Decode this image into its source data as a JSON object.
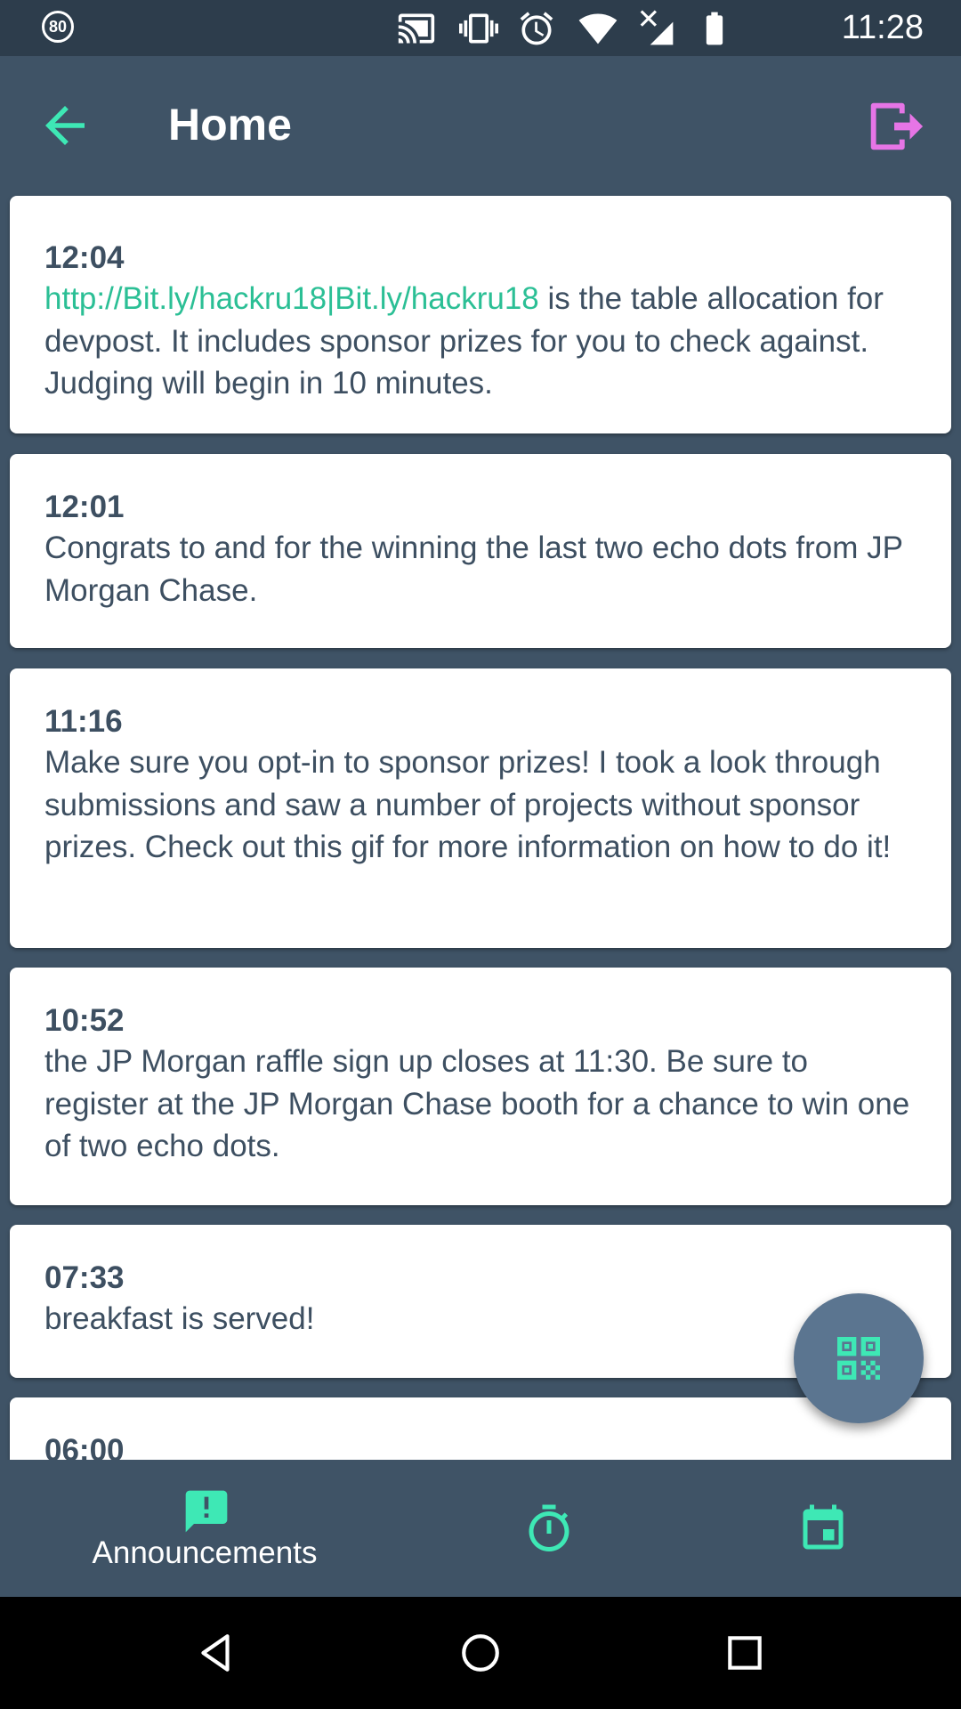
{
  "status_bar": {
    "badge": "80",
    "time": "11:28",
    "icons": [
      "cast-icon",
      "vibrate-icon",
      "alarm-icon",
      "wifi-icon",
      "no-signal-icon",
      "battery-icon"
    ]
  },
  "app_bar": {
    "title": "Home",
    "back_icon": "arrow-left-icon",
    "logout_icon": "logout-icon"
  },
  "announcements": [
    {
      "time": "12:04",
      "link": "http://Bit.ly/hackru18|Bit.ly/hackru18",
      "text": " is the table allocation for devpost. It includes sponsor prizes for you to check against. Judging will begin in 10 minutes."
    },
    {
      "time": "12:01",
      "text": "Congrats to and for the winning the last two echo dots from JP Morgan Chase."
    },
    {
      "time": "11:16",
      "text": "Make sure you opt-in to sponsor prizes! I took a look through submissions and saw a number of projects without sponsor prizes. Check out this gif for more information on how to do it!"
    },
    {
      "time": "10:52",
      "text": "the JP Morgan raffle sign up closes at 11:30. Be sure to register at the JP Morgan Chase booth for a chance to win one of two echo dots."
    },
    {
      "time": "07:33",
      "text": "breakfast is served!"
    },
    {
      "time": "06:00",
      "text": ""
    }
  ],
  "fab": {
    "icon": "qr-code-icon"
  },
  "bottom_nav": {
    "items": [
      {
        "label": "Announcements",
        "icon": "announcement-icon",
        "selected": true
      },
      {
        "icon": "timer-icon"
      },
      {
        "icon": "calendar-icon"
      }
    ]
  },
  "system_nav": {
    "icons": [
      "back-triangle-icon",
      "home-circle-icon",
      "recents-square-icon"
    ]
  },
  "colors": {
    "accent": "#3ee8b5",
    "link": "#2bbf95",
    "background": "#3f5366",
    "status_bar": "#2d3d4c",
    "text": "#3d4f61",
    "logout": "#e675e6",
    "fab": "#5b7590"
  }
}
